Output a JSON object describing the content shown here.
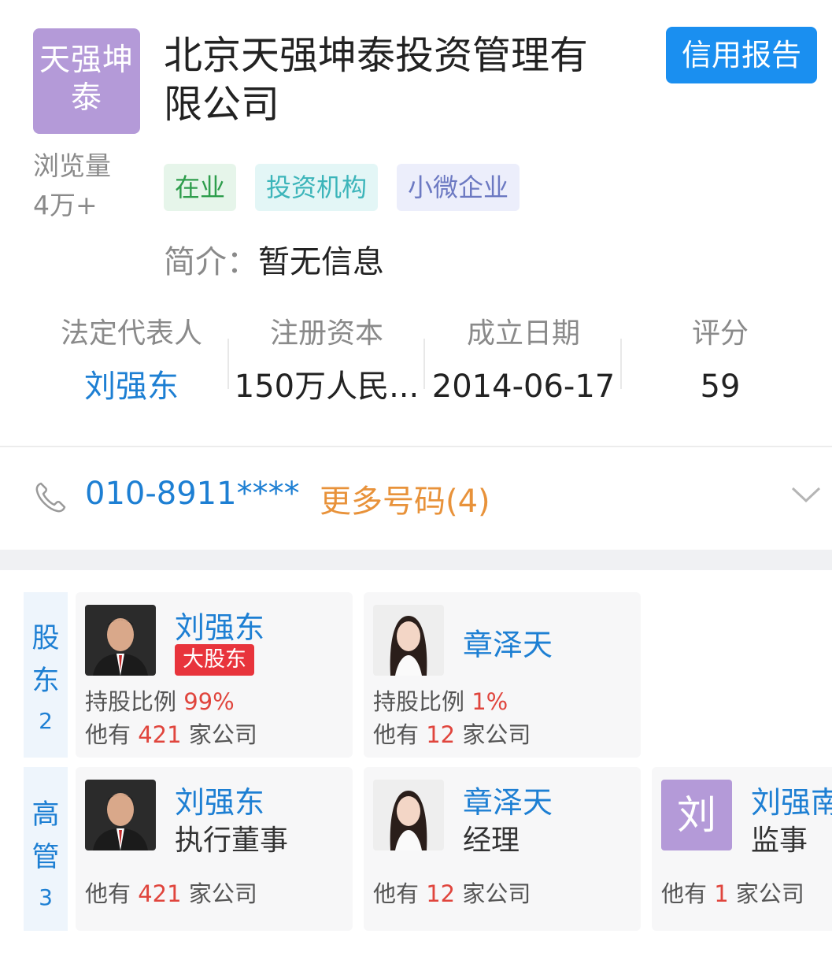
{
  "company": {
    "logo_text": "天强坤泰",
    "name": "北京天强坤泰投资管理有限公司",
    "views_label": "浏览量",
    "views_value": "4万+",
    "credit_button": "信用报告",
    "tags": [
      "在业",
      "投资机构",
      "小微企业"
    ],
    "intro_label": "简介：",
    "intro_value": "暂无信息"
  },
  "info": [
    {
      "key": "法定代表人",
      "value": "刘强东"
    },
    {
      "key": "注册资本",
      "value": "150万人民..."
    },
    {
      "key": "成立日期",
      "value": "2014-06-17"
    },
    {
      "key": "评分",
      "value": "59"
    }
  ],
  "contact": {
    "phone": "010-8911****",
    "more": "更多号码(4)"
  },
  "shareholders": {
    "label": "股东",
    "count": "2",
    "items": [
      {
        "name": "刘强东",
        "badge": "大股东",
        "ratio_label": "持股比例",
        "ratio": "99%",
        "companies_prefix": "他有",
        "companies_count": "421",
        "companies_suffix": "家公司"
      },
      {
        "name": "章泽天",
        "ratio_label": "持股比例",
        "ratio": "1%",
        "companies_prefix": "他有",
        "companies_count": "12",
        "companies_suffix": "家公司"
      }
    ]
  },
  "executives": {
    "label": "高管",
    "count": "3",
    "items": [
      {
        "name": "刘强东",
        "role": "执行董事",
        "companies_prefix": "他有",
        "companies_count": "421",
        "companies_suffix": "家公司"
      },
      {
        "name": "章泽天",
        "role": "经理",
        "companies_prefix": "他有",
        "companies_count": "12",
        "companies_suffix": "家公司"
      },
      {
        "name": "刘强南",
        "avatar_letter": "刘",
        "role": "监事",
        "companies_prefix": "他有",
        "companies_count": "1",
        "companies_suffix": "家公司"
      }
    ]
  },
  "colors": {
    "accent_blue": "#1d7fd3",
    "logo_purple": "#b49ad8",
    "orange": "#e8923a",
    "badge_red": "#e8343c"
  }
}
